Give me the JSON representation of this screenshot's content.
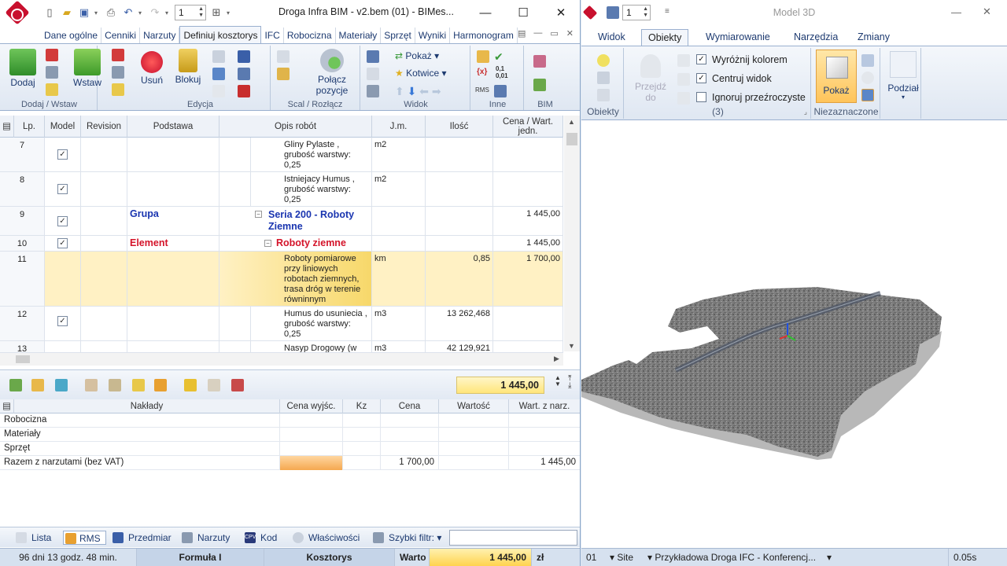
{
  "left_window": {
    "title": "Droga Infra BIM - v2.bem (01) - BIMes...",
    "spin_value": "1",
    "tabs": [
      "Dane ogólne",
      "Cenniki",
      "Narzuty",
      "Definiuj kosztorys",
      "IFC",
      "Robocizna",
      "Materiały",
      "Sprzęt",
      "Wyniki",
      "Harmonogram"
    ],
    "ribbon": {
      "dodaj": "Dodaj",
      "wstaw": "Wstaw",
      "group_dodaj": "Dodaj / Wstaw",
      "usun": "Usuń",
      "blokuj": "Blokuj",
      "group_edycja": "Edycja",
      "polacz": "Połącz",
      "pozycje": "pozycje",
      "group_scal": "Scal / Rozłącz",
      "pokaz": "Pokaż",
      "kotwice": "Kotwice",
      "group_widok": "Widok",
      "group_inne": "Inne",
      "group_bim": "BIM",
      "inne_fx": "{x}",
      "inne_num1": "0,1",
      "inne_num2": "0,01",
      "inne_rms": "RMS"
    },
    "grid": {
      "headers": [
        "Lp.",
        "Model",
        "Revision",
        "Podstawa",
        "Opis robót",
        "J.m.",
        "Ilość",
        "Cena / Wart. jedn."
      ],
      "rows": [
        {
          "lp": "7",
          "checked": "✓",
          "podstawa": "",
          "opis": "Gliny Pylaste , grubość warstwy: 0,25",
          "jm": "m2",
          "ilosc": "",
          "cena": ""
        },
        {
          "lp": "8",
          "checked": "✓",
          "podstawa": "",
          "opis": "Istniejacy Humus , grubość warstwy: 0,25",
          "jm": "m2",
          "ilosc": "",
          "cena": ""
        },
        {
          "lp": "9",
          "checked": "✓",
          "podstawa": "Grupa",
          "opis": "Seria 200 - Roboty Ziemne",
          "jm": "",
          "ilosc": "",
          "cena": "1 445,00"
        },
        {
          "lp": "10",
          "checked": "✓",
          "podstawa": "Element",
          "opis": "Roboty ziemne",
          "jm": "",
          "ilosc": "",
          "cena": "1 445,00"
        },
        {
          "lp": "11",
          "checked": "",
          "podstawa": "",
          "opis": "Roboty pomiarowe przy liniowych robotach ziemnych, trasa dróg w terenie równinnym",
          "jm": "km",
          "ilosc": "0,85",
          "cena": "1 700,00"
        },
        {
          "lp": "12",
          "checked": "✓",
          "podstawa": "",
          "opis": "Humus do usuniecia , grubość warstwy: 0,25",
          "jm": "m3",
          "ilosc": "13 262,468",
          "cena": ""
        },
        {
          "lp": "13",
          "checked": "",
          "podstawa": "",
          "opis": "Nasyp Drogowy (w",
          "jm": "m3",
          "ilosc": "42 129,921",
          "cena": ""
        }
      ]
    },
    "total": "1 445,00",
    "naklady": {
      "headers": [
        "Nakłady",
        "Cena wyjśc.",
        "Kz",
        "Cena",
        "Wartość",
        "Wart. z narz."
      ],
      "rows": [
        {
          "name": "Robocizna",
          "cena": "",
          "wart": ""
        },
        {
          "name": "Materiały",
          "cena": "",
          "wart": ""
        },
        {
          "name": "Sprzęt",
          "cena": "",
          "wart": ""
        },
        {
          "name": "Razem z narzutami (bez VAT)",
          "cena": "1 700,00",
          "wart": "1 445,00"
        }
      ]
    },
    "bottom_tabs": [
      "Lista",
      "RMS",
      "Przedmiar",
      "Narzuty",
      "Kod",
      "Właściwości",
      "Szybki filtr:"
    ],
    "bottom_tab_kod_icon": "CPV",
    "status": {
      "time": "96 dni 13 godz. 48 min.",
      "formula": "Formuła I",
      "mode": "Kosztorys",
      "label": "Warto",
      "value": "1 445,00",
      "currency": "zł"
    }
  },
  "right_window": {
    "title": "Model 3D",
    "spin_value": "1",
    "tabs": [
      "Widok",
      "Obiekty",
      "Wymiarowanie",
      "Narzędzia",
      "Zmiany"
    ],
    "ribbon": {
      "group_obiekty": "Obiekty",
      "przejdz": "Przejdź",
      "do": "do",
      "cb_wyroznij": "Wyróżnij kolorem",
      "cb_centruj": "Centruj widok",
      "cb_ignoruj": "Ignoruj przeźroczyste",
      "count": "(3)",
      "pokaz": "Pokaż",
      "group_niezaznaczone": "Niezaznaczone",
      "podzial": "Podział"
    },
    "status": {
      "level": "01",
      "site": "Site",
      "project": "Przykładowa Droga IFC - Konferencj...",
      "time": "0.05s"
    }
  },
  "colors": {
    "accent_red": "#c8102e",
    "group_blue": "#1a35b0",
    "element_red": "#d4142a",
    "highlight_row": "#fff1c4",
    "ribbon_bg": "#dfe7f2"
  }
}
